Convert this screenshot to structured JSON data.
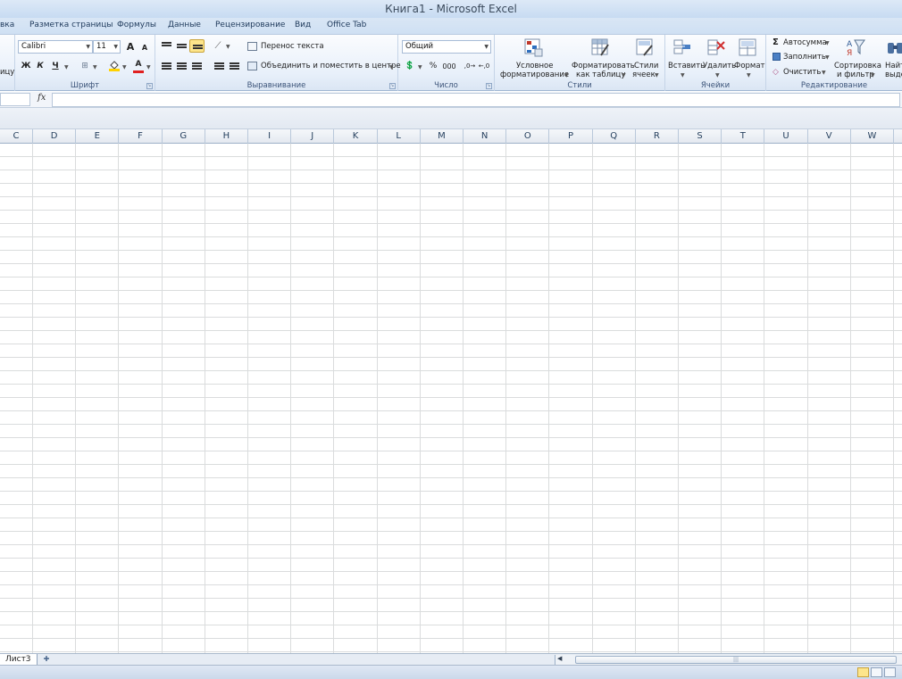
{
  "window": {
    "title": "Книга1  -  Microsoft Excel"
  },
  "tabs": [
    "вка",
    "Разметка страницы",
    "Формулы",
    "Данные",
    "Рецензирование",
    "Вид",
    "Office Tab"
  ],
  "ribbon": {
    "clipboard_partial_label": "ицу",
    "font": {
      "label": "Шрифт",
      "font_name": "Calibri",
      "font_size": "11",
      "bold": "Ж",
      "italic": "К",
      "underline": "Ч",
      "grow": "A",
      "shrink": "A",
      "font_color_glyph": "A"
    },
    "alignment": {
      "label": "Выравнивание",
      "wrap_text": "Перенос текста",
      "merge_center": "Объединить и поместить в центре"
    },
    "number": {
      "label": "Число",
      "format": "Общий",
      "percent": "%",
      "thousands": "000"
    },
    "styles": {
      "label": "Стили",
      "conditional": [
        "Условное",
        "форматирование"
      ],
      "format_table": [
        "Форматировать",
        "как таблицу"
      ],
      "cell_styles": [
        "Стили",
        "ячеек"
      ]
    },
    "cells": {
      "label": "Ячейки",
      "insert": "Вставить",
      "delete": "Удалить",
      "format": "Формат"
    },
    "editing": {
      "label": "Редактирование",
      "autosum": "Автосумма",
      "fill": "Заполнить",
      "clear": "Очистить",
      "sort_filter": [
        "Сортировка",
        "и фильтр"
      ],
      "find_select": [
        "Найти",
        "выдел"
      ]
    }
  },
  "formula_bar": {
    "fx": "fx"
  },
  "columns": [
    "C",
    "D",
    "E",
    "F",
    "G",
    "H",
    "I",
    "J",
    "K",
    "L",
    "M",
    "N",
    "O",
    "P",
    "Q",
    "R",
    "S",
    "T",
    "U",
    "V",
    "W"
  ],
  "sheets": {
    "active": "Лист3"
  },
  "colors": {
    "accent": "#fde58b",
    "ribbon_blue": "#dbe6f4",
    "gridline": "#dadcdd"
  }
}
